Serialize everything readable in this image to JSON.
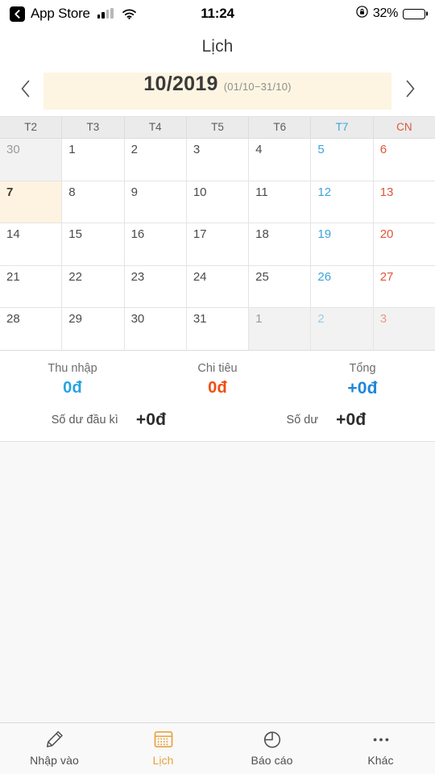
{
  "statusbar": {
    "back_icon": "chevron-left-icon",
    "carrier": "App Store",
    "signal_icon": "cellular-signal-icon",
    "wifi_icon": "wifi-icon",
    "time": "11:24",
    "rotation_lock_icon": "rotation-lock-icon",
    "battery_percent": "32%",
    "battery_icon": "battery-icon"
  },
  "navbar": {
    "title": "Lịch"
  },
  "monthbar": {
    "prev_icon": "chevron-left-icon",
    "next_icon": "chevron-right-icon",
    "month": "10/2019",
    "range": "(01/10−31/10)"
  },
  "calendar": {
    "weekdays": [
      {
        "label": "T2",
        "kind": "weekday"
      },
      {
        "label": "T3",
        "kind": "weekday"
      },
      {
        "label": "T4",
        "kind": "weekday"
      },
      {
        "label": "T5",
        "kind": "weekday"
      },
      {
        "label": "T6",
        "kind": "weekday"
      },
      {
        "label": "T7",
        "kind": "saturday"
      },
      {
        "label": "CN",
        "kind": "sunday"
      }
    ],
    "rows": [
      [
        {
          "day": "30",
          "month": "prev",
          "kind": "weekday",
          "today": false
        },
        {
          "day": "1",
          "month": "current",
          "kind": "weekday",
          "today": false
        },
        {
          "day": "2",
          "month": "current",
          "kind": "weekday",
          "today": false
        },
        {
          "day": "3",
          "month": "current",
          "kind": "weekday",
          "today": false
        },
        {
          "day": "4",
          "month": "current",
          "kind": "weekday",
          "today": false
        },
        {
          "day": "5",
          "month": "current",
          "kind": "saturday",
          "today": false
        },
        {
          "day": "6",
          "month": "current",
          "kind": "sunday",
          "today": false
        }
      ],
      [
        {
          "day": "7",
          "month": "current",
          "kind": "weekday",
          "today": true
        },
        {
          "day": "8",
          "month": "current",
          "kind": "weekday",
          "today": false
        },
        {
          "day": "9",
          "month": "current",
          "kind": "weekday",
          "today": false
        },
        {
          "day": "10",
          "month": "current",
          "kind": "weekday",
          "today": false
        },
        {
          "day": "11",
          "month": "current",
          "kind": "weekday",
          "today": false
        },
        {
          "day": "12",
          "month": "current",
          "kind": "saturday",
          "today": false
        },
        {
          "day": "13",
          "month": "current",
          "kind": "sunday",
          "today": false
        }
      ],
      [
        {
          "day": "14",
          "month": "current",
          "kind": "weekday",
          "today": false
        },
        {
          "day": "15",
          "month": "current",
          "kind": "weekday",
          "today": false
        },
        {
          "day": "16",
          "month": "current",
          "kind": "weekday",
          "today": false
        },
        {
          "day": "17",
          "month": "current",
          "kind": "weekday",
          "today": false
        },
        {
          "day": "18",
          "month": "current",
          "kind": "weekday",
          "today": false
        },
        {
          "day": "19",
          "month": "current",
          "kind": "saturday",
          "today": false
        },
        {
          "day": "20",
          "month": "current",
          "kind": "sunday",
          "today": false
        }
      ],
      [
        {
          "day": "21",
          "month": "current",
          "kind": "weekday",
          "today": false
        },
        {
          "day": "22",
          "month": "current",
          "kind": "weekday",
          "today": false
        },
        {
          "day": "23",
          "month": "current",
          "kind": "weekday",
          "today": false
        },
        {
          "day": "24",
          "month": "current",
          "kind": "weekday",
          "today": false
        },
        {
          "day": "25",
          "month": "current",
          "kind": "weekday",
          "today": false
        },
        {
          "day": "26",
          "month": "current",
          "kind": "saturday",
          "today": false
        },
        {
          "day": "27",
          "month": "current",
          "kind": "sunday",
          "today": false
        }
      ],
      [
        {
          "day": "28",
          "month": "current",
          "kind": "weekday",
          "today": false
        },
        {
          "day": "29",
          "month": "current",
          "kind": "weekday",
          "today": false
        },
        {
          "day": "30",
          "month": "current",
          "kind": "weekday",
          "today": false
        },
        {
          "day": "31",
          "month": "current",
          "kind": "weekday",
          "today": false
        },
        {
          "day": "1",
          "month": "next",
          "kind": "weekday",
          "today": false
        },
        {
          "day": "2",
          "month": "next",
          "kind": "saturday",
          "today": false
        },
        {
          "day": "3",
          "month": "next",
          "kind": "sunday",
          "today": false
        }
      ]
    ]
  },
  "summary": {
    "income_label": "Thu nhập",
    "income_value": "0đ",
    "expense_label": "Chi tiêu",
    "expense_value": "0đ",
    "total_label": "Tổng",
    "total_value": "+0đ",
    "opening_label": "Số dư đầu kì",
    "opening_value": "+0đ",
    "balance_label": "Số dư",
    "balance_value": "+0đ"
  },
  "tabbar": {
    "tabs": [
      {
        "label": "Nhập vào",
        "icon": "pencil-icon",
        "active": false
      },
      {
        "label": "Lịch",
        "icon": "calendar-icon",
        "active": true
      },
      {
        "label": "Báo cáo",
        "icon": "pie-chart-icon",
        "active": false
      },
      {
        "label": "Khác",
        "icon": "ellipsis-icon",
        "active": false
      }
    ]
  },
  "colors": {
    "accent": "#e8a33d",
    "income": "#29a3e0",
    "expense": "#ef4e12",
    "total": "#1e86d8",
    "saturday": "#3ba4dd",
    "sunday": "#e0553a",
    "today_bg": "#fdf3e0",
    "month_pill_bg": "#fdf5e2"
  }
}
